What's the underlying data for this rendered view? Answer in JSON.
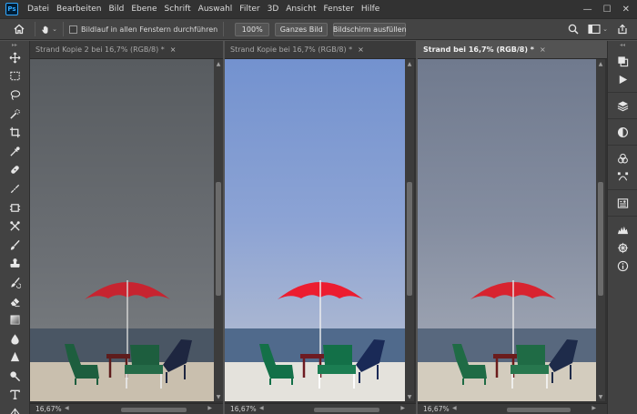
{
  "app": {
    "logo_text": "Ps"
  },
  "menu": [
    "Datei",
    "Bearbeiten",
    "Bild",
    "Ebene",
    "Schrift",
    "Auswahl",
    "Filter",
    "3D",
    "Ansicht",
    "Fenster",
    "Hilfe"
  ],
  "options": {
    "scroll_all_label": "Bildlauf in allen Fenstern durchführen",
    "zoom_button": "100%",
    "fit_button": "Ganzes Bild",
    "fill_button": "Bildschirm ausfüllen"
  },
  "documents": [
    {
      "title": "Strand Kopie 2 bei 16,7% (RGB/8) *",
      "active": false,
      "zoom": "16,67%",
      "tint": "gray"
    },
    {
      "title": "Strand Kopie bei 16,7% (RGB/8) *",
      "active": false,
      "zoom": "16,67%",
      "tint": "blue"
    },
    {
      "title": "Strand bei 16,7% (RGB/8) *",
      "active": true,
      "zoom": "16,67%",
      "tint": "natural"
    }
  ],
  "colors": {
    "accent": "#31a8ff",
    "umbrella": "#d8232f",
    "chair_green": "#1f6b45",
    "chair_navy": "#1e2b4a",
    "table_red": "#6b1c1c"
  },
  "tools": [
    "move-tool-icon",
    "marquee-tool-icon",
    "lasso-tool-icon",
    "quick-select-tool-icon",
    "crop-tool-icon",
    "eyedropper-tool-icon",
    "healing-brush-icon",
    "patch-tool-icon",
    "frame-tool-icon",
    "content-aware-move-icon",
    "brush-tool-icon",
    "stamp-tool-icon",
    "history-brush-icon",
    "eraser-tool-icon",
    "gradient-tool-icon",
    "blur-tool-icon",
    "sharpen-tool-icon",
    "dodge-tool-icon",
    "type-tool-icon",
    "pen-tool-icon"
  ],
  "right_panels": [
    "color-panel-icon",
    "play-action-icon",
    "layers-panel-icon",
    "adjustments-panel-icon",
    "channels-panel-icon",
    "paths-panel-icon",
    "properties-panel-icon",
    "histogram-panel-icon",
    "navigator-panel-icon",
    "info-panel-icon"
  ]
}
